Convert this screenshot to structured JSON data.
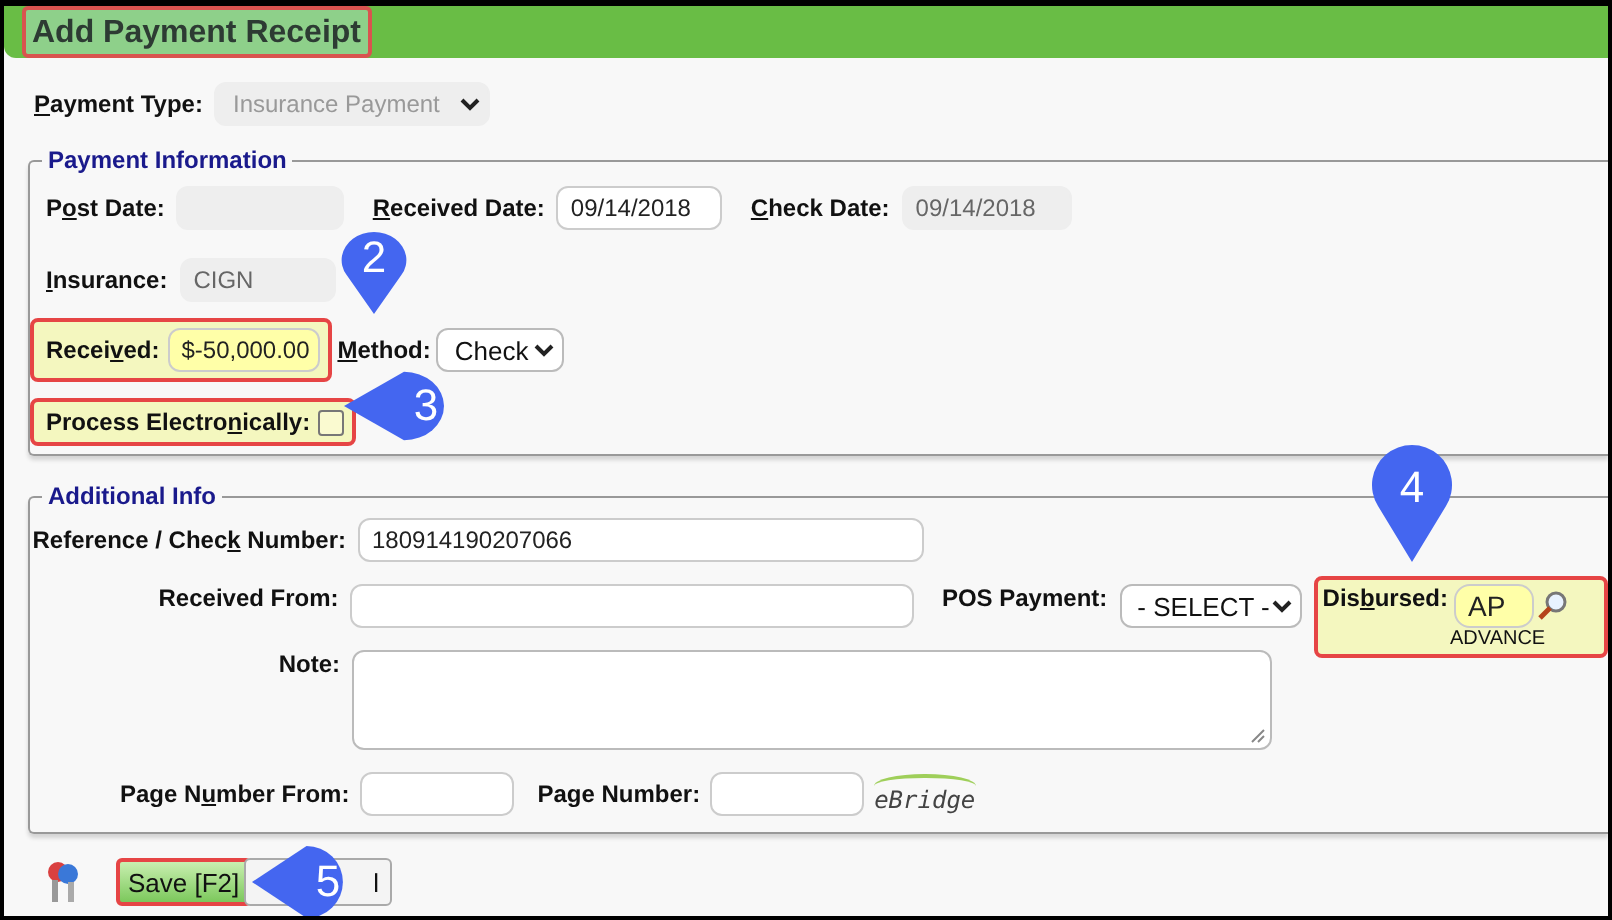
{
  "title": {
    "text": "Add Payment Receipt",
    "highlighted": true
  },
  "payment_type": {
    "label": {
      "key": "P",
      "post": "ayment Type:"
    },
    "value": "Insurance Payment",
    "disabled": true
  },
  "payment_information": {
    "legend": "Payment Information",
    "post_date": {
      "label": {
        "pre": "P",
        "key": "o",
        "post": "st Date:"
      },
      "disabled": true
    },
    "received_date": {
      "label": {
        "key": "R",
        "post": "eceived Date:"
      },
      "value": "09/14/2018",
      "disabled": false
    },
    "check_date": {
      "label": {
        "key": "C",
        "post": "heck Date:"
      },
      "value": "09/14/2018",
      "disabled": true
    },
    "insurance": {
      "label": {
        "key": "I",
        "post": "nsurance:"
      },
      "value": "CIGN",
      "disabled": true
    },
    "received": {
      "label": {
        "pre": "Recei",
        "key": "v",
        "post": "ed:"
      },
      "value": "$-50,000.00",
      "highlighted": true
    },
    "method": {
      "label": {
        "key": "M",
        "post": "ethod:"
      },
      "value": "Check"
    },
    "process_electronically": {
      "label": {
        "pre": "Process Electro",
        "key": "n",
        "post": "ically:"
      },
      "checked": false,
      "highlighted": true
    }
  },
  "additional_info": {
    "legend": "Additional Info",
    "reference": {
      "label": {
        "pre": "Reference / Chec",
        "key": "k",
        "post": " Number:"
      },
      "value": "180914190207066"
    },
    "received_from": {
      "label": {
        "pre": "Received From:"
      }
    },
    "pos_payment": {
      "label": {
        "pre": "POS Payment:"
      },
      "value": "- SELECT -"
    },
    "disbursed": {
      "label": {
        "pre": "Dis",
        "key": "b",
        "post": "ursed:"
      },
      "value": "AP",
      "caption": "ADVANCE",
      "highlighted": true
    },
    "note": {
      "label": {
        "pre": "Note:"
      }
    },
    "page_number_from": {
      "label": {
        "pre": "Page N",
        "key": "u",
        "post": "mber From:"
      }
    },
    "page_number": {
      "label": {
        "pre": "Page Number:"
      }
    },
    "logo": "eBridge"
  },
  "buttons": [
    {
      "label": "Save [F2]",
      "kind": "save",
      "highlighted": true
    },
    {
      "label": "l",
      "kind": "cancel",
      "highlighted": false
    }
  ],
  "callouts": [
    {
      "number": "2"
    },
    {
      "number": "3"
    },
    {
      "number": "4"
    },
    {
      "number": "5"
    }
  ]
}
